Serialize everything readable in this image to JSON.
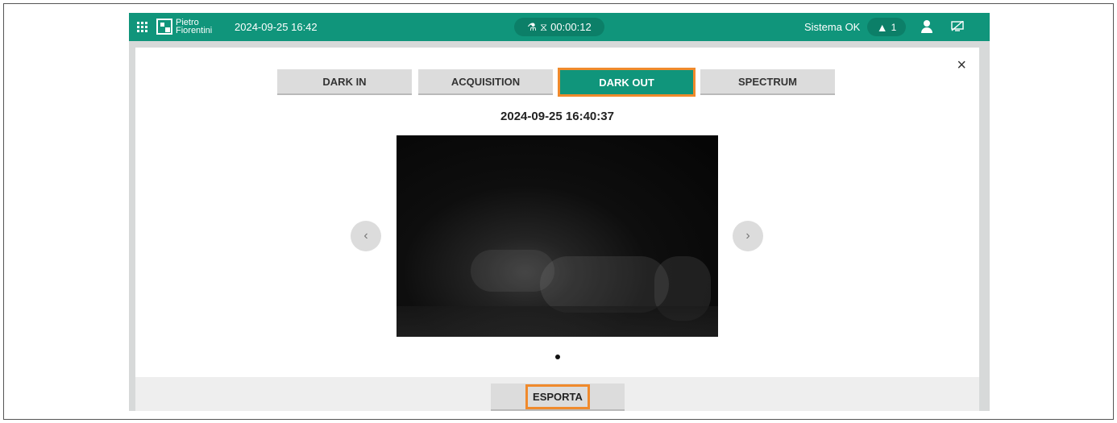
{
  "header": {
    "logo_line1": "Pietro",
    "logo_line2": "Fiorentini",
    "datetime": "2024-09-25 16:42",
    "timer": "00:00:12",
    "status": "Sistema OK",
    "alert_count": "1",
    "icons": [
      "apps-grid-icon",
      "flask-icon",
      "hourglass-icon",
      "warning-icon",
      "user-icon",
      "screen-off-icon"
    ],
    "accent_color": "#10957b"
  },
  "modal": {
    "close_label": "×",
    "tabs": [
      {
        "label": "DARK IN",
        "active": false
      },
      {
        "label": "ACQUISITION",
        "active": false
      },
      {
        "label": "DARK OUT",
        "active": true
      },
      {
        "label": "SPECTRUM",
        "active": false
      }
    ],
    "capture_time": "2024-09-25 16:40:37",
    "prev_label": "‹",
    "next_label": "›",
    "export_label": "ESPORTA",
    "highlight_color": "#f08a2c"
  }
}
